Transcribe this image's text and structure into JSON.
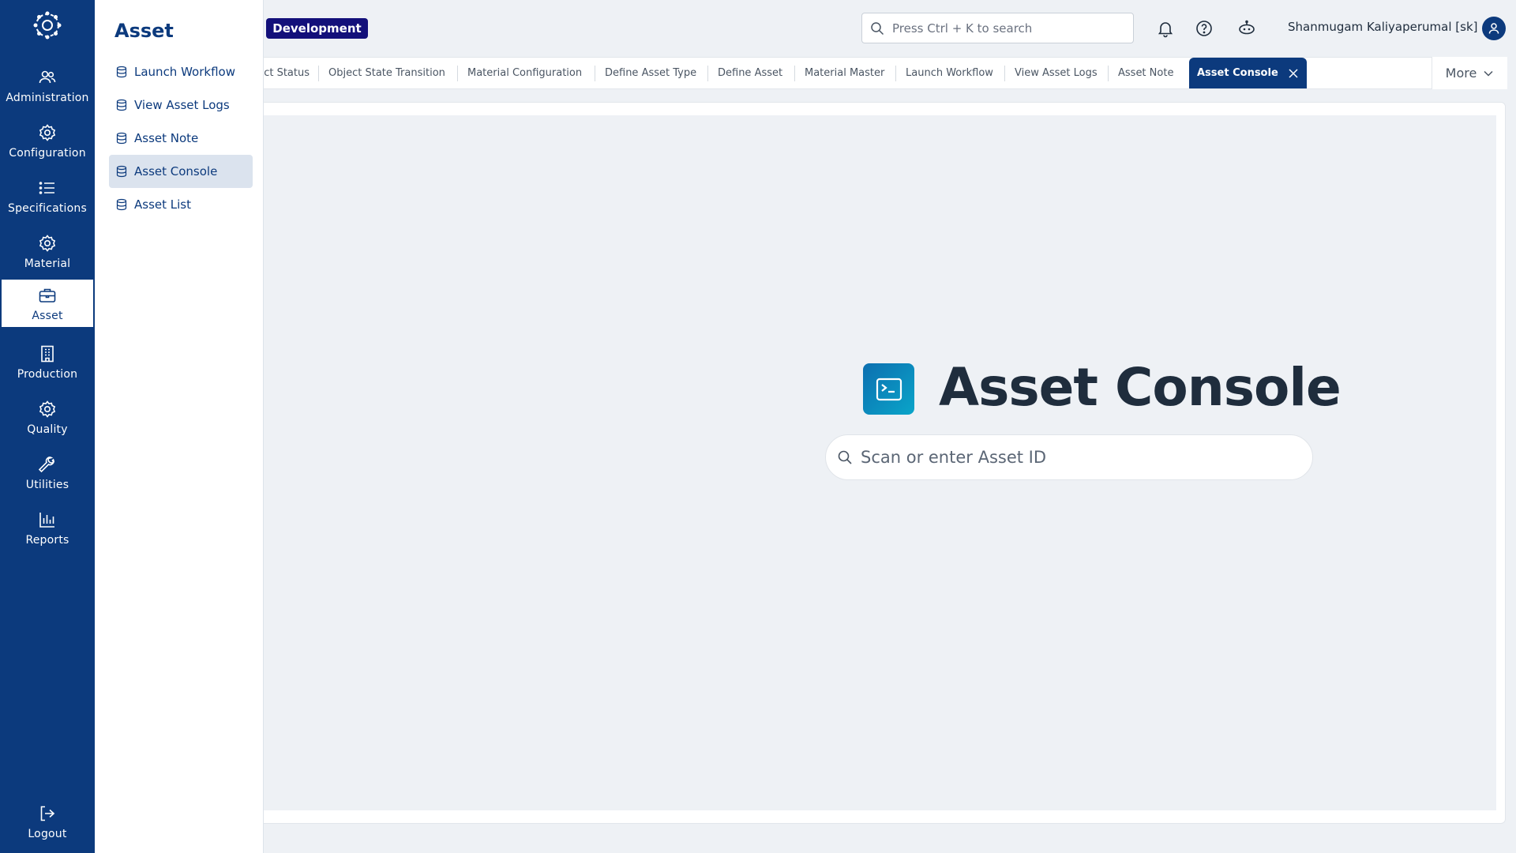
{
  "rail": {
    "items": [
      {
        "label": "Administration",
        "icon": "users-icon"
      },
      {
        "label": "Configuration",
        "icon": "gear-icon"
      },
      {
        "label": "Specifications",
        "icon": "list-icon"
      },
      {
        "label": "Material",
        "icon": "gear-icon"
      },
      {
        "label": "Asset",
        "icon": "briefcase-icon"
      },
      {
        "label": "Production",
        "icon": "building-icon"
      },
      {
        "label": "Quality",
        "icon": "gear-icon"
      },
      {
        "label": "Utilities",
        "icon": "wrench-icon"
      },
      {
        "label": "Reports",
        "icon": "bar-chart-icon"
      }
    ],
    "logout": "Logout",
    "active": "Asset"
  },
  "flyout": {
    "title": "Asset",
    "items": [
      {
        "label": "Launch Workflow"
      },
      {
        "label": "View Asset Logs"
      },
      {
        "label": "Asset Note"
      },
      {
        "label": "Asset Console"
      },
      {
        "label": "Asset List"
      }
    ],
    "active": "Asset Console"
  },
  "header": {
    "environment": "Development",
    "search_placeholder": "Press Ctrl + K to search",
    "user_name": "Shanmugam Kaliyaperumal [sk]"
  },
  "tabs": {
    "items": [
      {
        "label": "ct Status"
      },
      {
        "label": "Object State Transition"
      },
      {
        "label": "Material Configuration"
      },
      {
        "label": "Define Asset Type"
      },
      {
        "label": "Define Asset"
      },
      {
        "label": "Material Master"
      },
      {
        "label": "Launch Workflow"
      },
      {
        "label": "View Asset Logs"
      },
      {
        "label": "Asset Note"
      },
      {
        "label": "Asset Console"
      }
    ],
    "active": "Asset Console",
    "more_label": "More"
  },
  "main": {
    "title": "Asset Console",
    "search_placeholder": "Scan or enter Asset ID"
  },
  "colors": {
    "brand": "#0c3a7d",
    "env_badge": "#13107a",
    "background": "#eef1f5"
  }
}
